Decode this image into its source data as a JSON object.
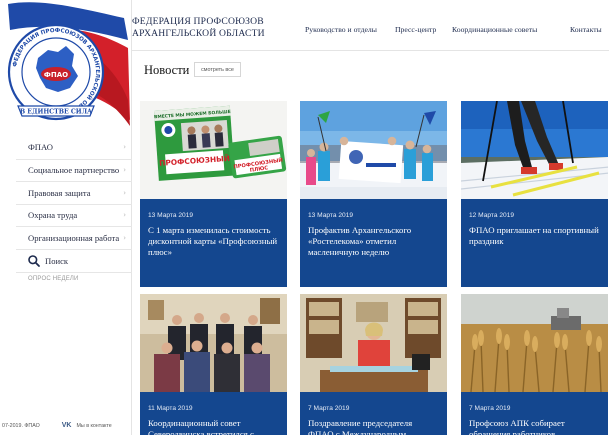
{
  "header": {
    "org_name_line1": "ФЕДЕРАЦИЯ ПРОФСОЮЗОВ",
    "org_name_line2": "АРХАНГЕЛЬСКОЙ ОБЛАСТИ",
    "nav": [
      "Руководство и отделы",
      "Пресс-центр",
      "Координационные советы",
      "Контакты"
    ]
  },
  "logo": {
    "ring_text": "ФЕДЕРАЦИЯ ПРОФСОЮЗОВ АРХАНГЕЛЬСКОЙ ОБЛАСТИ",
    "center_text": "ФПАО",
    "banner_text": "В ЕДИНСТВЕ СИЛА"
  },
  "sidebar": {
    "items": [
      "ФПАО",
      "Социальное партнерство",
      "Правовая защита",
      "Охрана труда",
      "Организационная работа"
    ],
    "search_label": "Поиск",
    "poll_label": "ОПРОС НЕДЕЛИ",
    "footer_copy": "07-2019. ФПАО",
    "footer_vk": "Мы в контакте"
  },
  "news": {
    "title": "Новости",
    "see_all": "смотреть все",
    "cards": [
      {
        "date": "13 Марта 2019",
        "title": "С 1 марта изменилась стоимость дисконтной карты «Профсоюзный плюс»"
      },
      {
        "date": "13 Марта 2019",
        "title": "Профактив Архангельского «Ростелекома» отметил масленичную неделю"
      },
      {
        "date": "12 Марта 2019",
        "title": "ФПАО приглашает на спортивный праздник"
      },
      {
        "date": "11 Марта 2019",
        "title": "Координационный совет Северодвинска встретился с"
      },
      {
        "date": "7 Марта 2019",
        "title": "Поздравление председателя ФПАО с Международным"
      },
      {
        "date": "7 Марта 2019",
        "title": "Профсоюз АПК собирает обращения работников"
      }
    ]
  },
  "photo_text": {
    "card_banner": "ВМЕСТЕ МЫ МОЖЕМ БОЛЬШЕ",
    "card_word1": "ПРОФСОЮЗНЫЙ",
    "card_word2": "ПЛЮС"
  },
  "colors": {
    "brand_blue": "#14478f",
    "text_dark": "#1d2a4d",
    "logo_red": "#d3202a"
  }
}
